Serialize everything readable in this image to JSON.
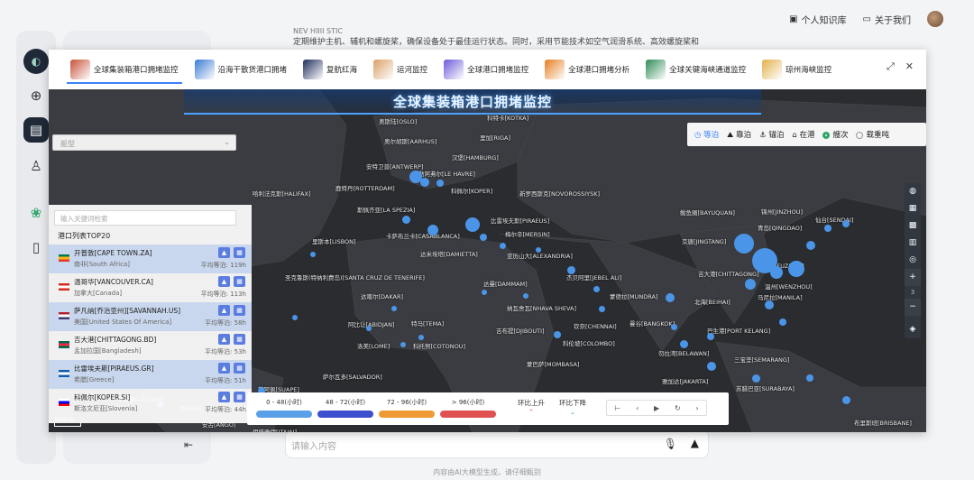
{
  "topbar": {
    "kb_label": "个人知识库",
    "about_label": "关于我们"
  },
  "background": {
    "header_text": "NEV HIIII STIC",
    "body_text": "定期维护主机、辅机和螺旋桨，确保设备处于最佳运行状态。同时，采用节能技术如空气润滑系统、高效螺旋桨和",
    "chat_placeholder": "请输入内容",
    "footer_note": "内容由AI大模型生成，请仔细甄别"
  },
  "tabs": [
    {
      "label": "全球集装箱港口拥堵监控",
      "color": "#c8523a",
      "active": true
    },
    {
      "label": "沿海干散货港口拥堵",
      "color": "#3a7bd5",
      "active": false
    },
    {
      "label": "复航红海",
      "color": "#1f2d5c",
      "active": false
    },
    {
      "label": "运河监控",
      "color": "#d9a066",
      "active": false
    },
    {
      "label": "全球港口拥堵监控",
      "color": "#6b5bd8",
      "active": false
    },
    {
      "label": "全球港口拥堵分析",
      "color": "#e67e22",
      "active": false
    },
    {
      "label": "全球关键海峡通道监控",
      "color": "#2e8b57",
      "active": false
    },
    {
      "label": "琼州海峡监控",
      "color": "#e3b04b",
      "active": false
    }
  ],
  "map": {
    "title": "全球集装箱港口拥堵监控",
    "vessel_type_placeholder": "船型",
    "search_placeholder": "输入关键词检索",
    "list_title": "港口列表TOP20",
    "scale_label": "500nm",
    "modes": [
      "等泊",
      "靠泊",
      "锚泊",
      "在港"
    ],
    "unit_options": [
      "艘次",
      "载重吨"
    ],
    "zoom_level": "3",
    "ports": [
      {
        "name": "开普敦[CAPE TOWN.ZA]",
        "country": "南非[South Africa]",
        "wait": "平均等泊: 119h",
        "flag": "za"
      },
      {
        "name": "温哥华[VANCOUVER.CA]",
        "country": "加拿大[Canada]",
        "wait": "平均等泊: 113h",
        "flag": "ca"
      },
      {
        "name": "萨凡纳[乔治亚州][SAVANNAH.US]",
        "country": "美国[United States Of America]",
        "wait": "平均等泊: 58h",
        "flag": "us"
      },
      {
        "name": "吉大港[CHITTAGONG.BD]",
        "country": "孟加拉国[Bangladesh]",
        "wait": "平均等泊: 53h",
        "flag": "bd"
      },
      {
        "name": "比雷埃夫斯[PIRAEUS.GR]",
        "country": "希腊[Greece]",
        "wait": "平均等泊: 51h",
        "flag": "gr"
      },
      {
        "name": "科佩尔[KOPER.SI]",
        "country": "斯洛文尼亚[Slovenia]",
        "wait": "平均等泊: 44h",
        "flag": "si"
      }
    ],
    "legend": [
      {
        "label": "0 - 48(小时)",
        "color": "#5aa0e8"
      },
      {
        "label": "48 - 72(小时)",
        "color": "#3d4fcf"
      },
      {
        "label": "72 - 96(小时)",
        "color": "#ef9a35"
      },
      {
        "label": "> 96(小时)",
        "color": "#e05252"
      }
    ],
    "trend_up": "环比上升",
    "trend_down": "环比下降",
    "labels": [
      {
        "t": "奥斯陆[OSLO]"
      },
      {
        "t": "科特卡[KOTKA]"
      },
      {
        "t": "里加[RIGA]"
      },
      {
        "t": "奥尔胡斯[AARHUS]"
      },
      {
        "t": "汉堡[HAMBURG]"
      },
      {
        "t": "安特卫普[ANTWERP]"
      },
      {
        "t": "勒阿弗尔[LE HAVRE]"
      },
      {
        "t": "鹿特丹[ROTTERDAM]"
      },
      {
        "t": "科佩尔[KOPER]"
      },
      {
        "t": "新罗西斯克[NOVOROSSIYSK]"
      },
      {
        "t": "哈利法克斯[HALIFAX]"
      },
      {
        "t": "斯佩齐亚[LA SPEZIA]"
      },
      {
        "t": "比雷埃夫斯[PIRAEUS]"
      },
      {
        "t": "卡萨布兰卡[CASABLANCA]"
      },
      {
        "t": "梅尔辛[MERSIN]"
      },
      {
        "t": "里斯本[LISBON]"
      },
      {
        "t": "达米埃塔[DAMIETTA]"
      },
      {
        "t": "亚历山大[ALEXANDRIA]"
      },
      {
        "t": "圣克鲁斯(特纳利费岛)[SANTA CRUZ DE TENERIFE]"
      },
      {
        "t": "达曼[DAMMAM]"
      },
      {
        "t": "杰贝阿里[JEBEL ALI]"
      },
      {
        "t": "达喀尔[DAKAR]"
      },
      {
        "t": "纳瓦舍瓦[NHAVA SHEVA]"
      },
      {
        "t": "蒙德拉[MUNDRA]"
      },
      {
        "t": "阿比让[ABIDJAN]"
      },
      {
        "t": "特马[TEMA]"
      },
      {
        "t": "吉布提[DJIBOUTI]"
      },
      {
        "t": "钦奈[CHENNAI]"
      },
      {
        "t": "曼谷[BANGKOK]"
      },
      {
        "t": "洛美[LOME]"
      },
      {
        "t": "科托努[COTONOU]"
      },
      {
        "t": "科伦坡[COLOMBO]"
      },
      {
        "t": "蒙巴萨[MOMBASA]"
      },
      {
        "t": "萨尔瓦多[SALVADOR]"
      },
      {
        "t": "苏阿佩[SUAPE]"
      },
      {
        "t": "卡亚俄[CALLAO]"
      },
      {
        "t": "里约热内卢[RIO DE JANEIRO]"
      },
      {
        "t": "鲅鱼圈[BAYUQUAN]"
      },
      {
        "t": "锦州[JINZHOU]"
      },
      {
        "t": "仙台[SENDAI]"
      },
      {
        "t": "青岛[QINGDAO]"
      },
      {
        "t": "京唐[JINGTANG]"
      },
      {
        "t": "福州[FUZHOU]"
      },
      {
        "t": "吉大港[CHITTAGONG]"
      },
      {
        "t": "温州[WENZHOU]"
      },
      {
        "t": "北海[BEIHAI]"
      },
      {
        "t": "马尼拉[MANILA]"
      },
      {
        "t": "巴生港[PORT KELANG]"
      },
      {
        "t": "勿拉湾[BELAWAN]"
      },
      {
        "t": "三宝垄[SEMARANG]"
      },
      {
        "t": "雅加达[JAKARTA]"
      },
      {
        "t": "苏腊巴亚[SURABAYA]"
      },
      {
        "t": "布里斯班[BRISBANE]"
      },
      {
        "t": "伊塔雅伊[ITAJAI]"
      },
      {
        "t": "安古[ANGO]"
      }
    ]
  }
}
